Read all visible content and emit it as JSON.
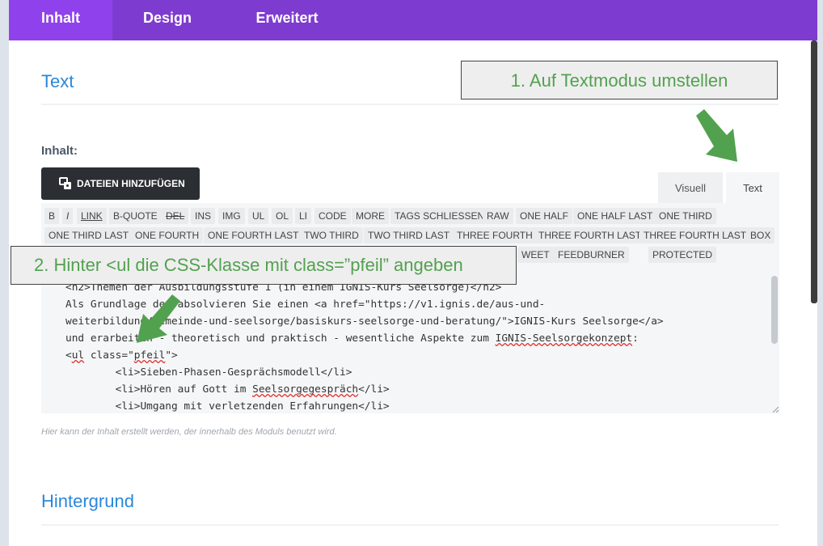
{
  "tabs": [
    {
      "label": "Inhalt",
      "active": true
    },
    {
      "label": "Design",
      "active": false
    },
    {
      "label": "Erweitert",
      "active": false
    }
  ],
  "section_text": {
    "title": "Text"
  },
  "content": {
    "label": "Inhalt:",
    "add_files_button": "DATEIEN HINZUFÜGEN",
    "mode_tabs": {
      "visual": "Visuell",
      "text": "Text",
      "active": "Text"
    },
    "quicktags": {
      "b": "B",
      "i": "I",
      "link": "LINK",
      "bquote": "B-QUOTE",
      "del": "DEL",
      "ins": "INS",
      "img": "IMG",
      "ul": "UL",
      "ol": "OL",
      "li": "LI",
      "code": "CODE",
      "more": "MORE",
      "close_tags": "TAGS SCHLIESSEN",
      "raw": "RAW",
      "one_half": "ONE HALF",
      "one_half_last": "ONE HALF LAST",
      "one_third": "ONE THIRD",
      "one_third_last": "ONE THIRD LAST",
      "one_fourth": "ONE FOURTH",
      "one_fourth_last": "ONE FOURTH LAST",
      "two_third": "TWO THIRD",
      "two_third_last": "TWO THIRD LAST",
      "three_fourth": "THREE FOURTH",
      "three_fourth_last_1": "THREE FOURTH LAST",
      "three_fourth_last_2": "THREE FOURTH LAST",
      "box": "BOX",
      "tweet": "WEET",
      "feedburner": "FEEDBURNER",
      "protected": "PROTECTED"
    },
    "code": {
      "l1": "<h2>Themen der Ausbildungsstufe 1 (in einem IGNIS-Kurs Seelsorge)</h2>",
      "l2": "Als Grundlage der absolvieren Sie einen <a href=\"https://v1.ignis.de/aus-und-",
      "l3a": "weiterbildung/gemeinde-und-seelsorge/basiskurs-seelsorge-und-beratung/\">IGNIS-Kurs Seelsorge</a>",
      "l4a": "und erarbeiten - theoretisch und praktisch - wesentliche Aspekte zum ",
      "l4b": "IGNIS-Seelsorgekonzept",
      "l4c": ":",
      "l5a": "<",
      "l5b": "ul",
      "l5c": " class=\"",
      "l5d": "pfeil",
      "l5e": "\">",
      "l6": "        <li>Sieben-Phasen-Gesprächsmodell</li>",
      "l7a": "        <li>Hören auf Gott im ",
      "l7b": "Seelsorgegespräch",
      "l7c": "</li>",
      "l8": "        <li>Umgang mit verletzenden Erfahrungen</li>"
    },
    "description": "Hier kann der Inhalt erstellt werden, der innerhalb des Moduls benutzt wird."
  },
  "section_background": {
    "title": "Hintergrund"
  },
  "annotations": {
    "step1": "1. Auf Textmodus umstellen",
    "step2": "2. Hinter <ul die CSS-Klasse mit class=”pfeil” angeben",
    "color": "#52a14f"
  }
}
